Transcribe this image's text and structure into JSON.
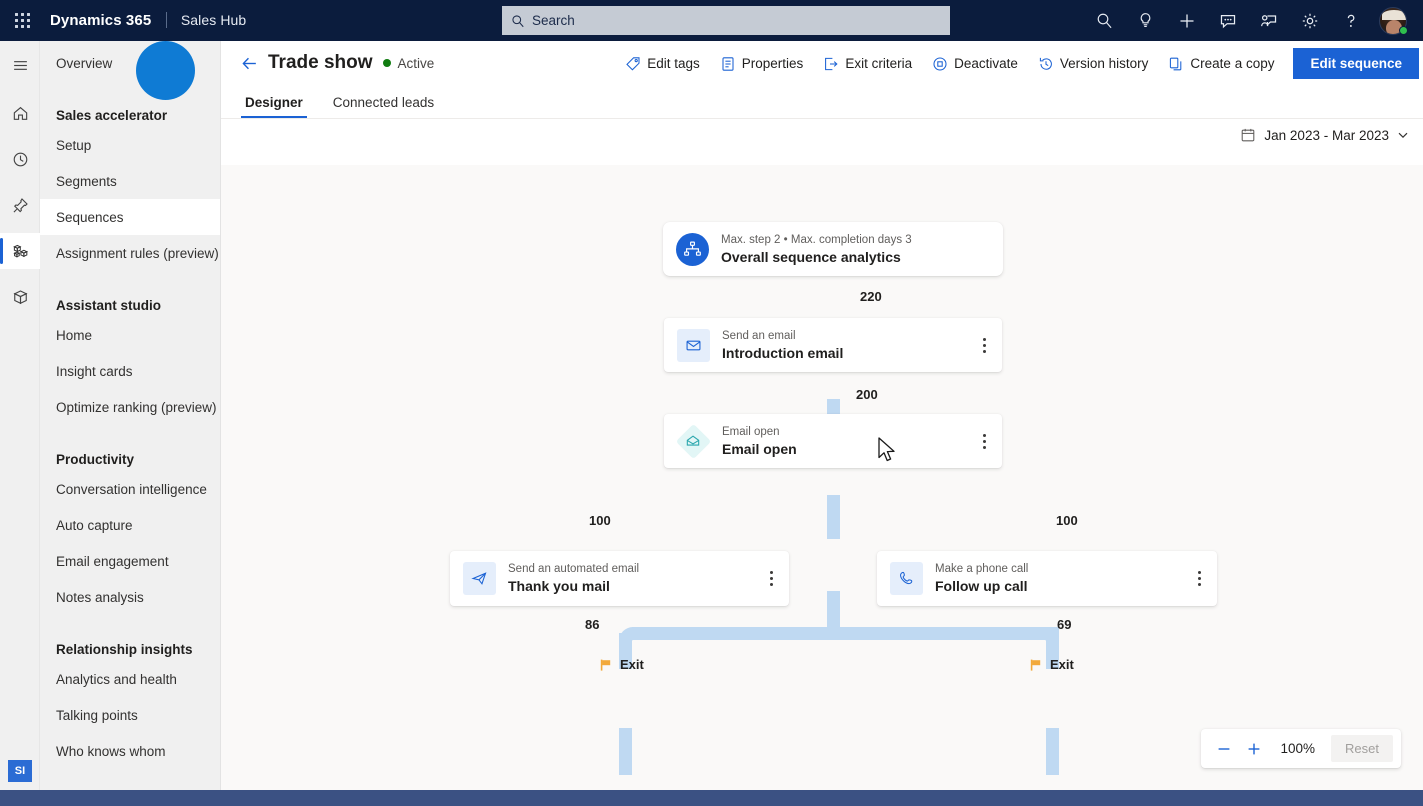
{
  "topbar": {
    "waffle_label": "App launcher",
    "brand": "Dynamics 365",
    "app_name": "Sales Hub",
    "search_placeholder": "Search",
    "icons": [
      {
        "name": "search-icon",
        "label": "Search"
      },
      {
        "name": "lightbulb-icon",
        "label": "Insights"
      },
      {
        "name": "plus-icon",
        "label": "New"
      },
      {
        "name": "feedback-icon",
        "label": "Feedback"
      },
      {
        "name": "assistant-icon",
        "label": "Assistant"
      },
      {
        "name": "gear-icon",
        "label": "Settings"
      },
      {
        "name": "question-icon",
        "label": "Help"
      }
    ],
    "avatar_presence": "#2fbf4e"
  },
  "rail": {
    "items": [
      {
        "name": "hamburger-icon",
        "label": "Expand navigation"
      },
      {
        "name": "home-icon",
        "label": "Home"
      },
      {
        "name": "clock-icon",
        "label": "Recent"
      },
      {
        "name": "pin-icon",
        "label": "Pinned"
      },
      {
        "name": "sales-accelerator-icon",
        "label": "Sales accelerator",
        "selected": true
      },
      {
        "name": "package-icon",
        "label": "Apps"
      }
    ],
    "badge": "SI"
  },
  "sidebar": {
    "top_items": [
      {
        "label": "Overview",
        "selected": false
      }
    ],
    "groups": [
      {
        "title": "Sales accelerator",
        "items": [
          {
            "label": "Setup",
            "selected": false
          },
          {
            "label": "Segments",
            "selected": false
          },
          {
            "label": "Sequences",
            "selected": true
          },
          {
            "label": "Assignment rules (preview)",
            "selected": false
          }
        ]
      },
      {
        "title": "Assistant studio",
        "items": [
          {
            "label": "Home",
            "selected": false
          },
          {
            "label": "Insight cards",
            "selected": false
          },
          {
            "label": "Optimize ranking (preview)",
            "selected": false
          }
        ]
      },
      {
        "title": "Productivity",
        "items": [
          {
            "label": "Conversation intelligence",
            "selected": false
          },
          {
            "label": "Auto capture",
            "selected": false
          },
          {
            "label": "Email engagement",
            "selected": false
          },
          {
            "label": "Notes analysis",
            "selected": false
          }
        ]
      },
      {
        "title": "Relationship insights",
        "items": [
          {
            "label": "Analytics and health",
            "selected": false
          },
          {
            "label": "Talking points",
            "selected": false
          },
          {
            "label": "Who knows whom",
            "selected": false
          }
        ]
      }
    ]
  },
  "page": {
    "title": "Trade show",
    "status": "Active",
    "status_color": "#107c10",
    "commands": [
      {
        "label": "Edit tags",
        "icon": "tag-icon"
      },
      {
        "label": "Properties",
        "icon": "properties-icon"
      },
      {
        "label": "Exit criteria",
        "icon": "exit-criteria-icon"
      },
      {
        "label": "Deactivate",
        "icon": "deactivate-icon"
      },
      {
        "label": "Version history",
        "icon": "history-icon"
      },
      {
        "label": "Create a copy",
        "icon": "copy-icon"
      }
    ],
    "primary_command": "Edit sequence",
    "tabs": [
      {
        "label": "Designer",
        "selected": true
      },
      {
        "label": "Connected leads",
        "selected": false
      }
    ],
    "date_range": "Jan 2023 - Mar 2023"
  },
  "flow": {
    "header_node": {
      "meta": "Max. step 2 • Max. completion days 3",
      "title": "Overall sequence analytics",
      "icon": "sequence-analytics-icon"
    },
    "nodes": [
      {
        "id": "intro-email",
        "type": "Send an email",
        "title": "Introduction email",
        "icon": "envelope-icon"
      },
      {
        "id": "email-open",
        "type": "Email open",
        "title": "Email open",
        "icon": "email-open-icon"
      },
      {
        "id": "thank-you",
        "type": "Send an automated email",
        "title": "Thank you mail",
        "icon": "paper-plane-icon"
      },
      {
        "id": "follow-up",
        "type": "Make a phone call",
        "title": "Follow up call",
        "icon": "phone-icon"
      }
    ],
    "edge_labels": {
      "to_intro": "220",
      "to_email_open": "200",
      "branch_left": "100",
      "branch_right": "100",
      "left_exit": "86",
      "right_exit": "69"
    },
    "exits": [
      {
        "label": "Exit",
        "icon": "flag-icon"
      },
      {
        "label": "Exit",
        "icon": "flag-icon"
      }
    ],
    "connector_color": "#bfd9f2",
    "exit_flag_color": "#f2a93b"
  },
  "zoom_control": {
    "minus_label": "Zoom out",
    "plus_label": "Zoom in",
    "level": "100%",
    "reset_label": "Reset"
  },
  "chart_data": {
    "type": "diagram",
    "title": "Overall sequence analytics",
    "subtitle": "Max. step 2 • Max. completion days 3",
    "date_range": "Jan 2023 - Mar 2023",
    "nodes": [
      {
        "id": "start",
        "label": "Overall sequence analytics",
        "kind": "summary"
      },
      {
        "id": "intro-email",
        "label": "Introduction email",
        "kind": "Send an email"
      },
      {
        "id": "email-open",
        "label": "Email open",
        "kind": "Email open"
      },
      {
        "id": "thank-you",
        "label": "Thank you mail",
        "kind": "Send an automated email"
      },
      {
        "id": "follow-up",
        "label": "Follow up call",
        "kind": "Make a phone call"
      },
      {
        "id": "exit-left",
        "label": "Exit",
        "kind": "exit"
      },
      {
        "id": "exit-right",
        "label": "Exit",
        "kind": "exit"
      }
    ],
    "edges": [
      {
        "from": "start",
        "to": "intro-email",
        "value": 220
      },
      {
        "from": "intro-email",
        "to": "email-open",
        "value": 200
      },
      {
        "from": "email-open",
        "to": "thank-you",
        "value": 100
      },
      {
        "from": "email-open",
        "to": "follow-up",
        "value": 100
      },
      {
        "from": "thank-you",
        "to": "exit-left",
        "value": 86
      },
      {
        "from": "follow-up",
        "to": "exit-right",
        "value": 69
      }
    ]
  }
}
